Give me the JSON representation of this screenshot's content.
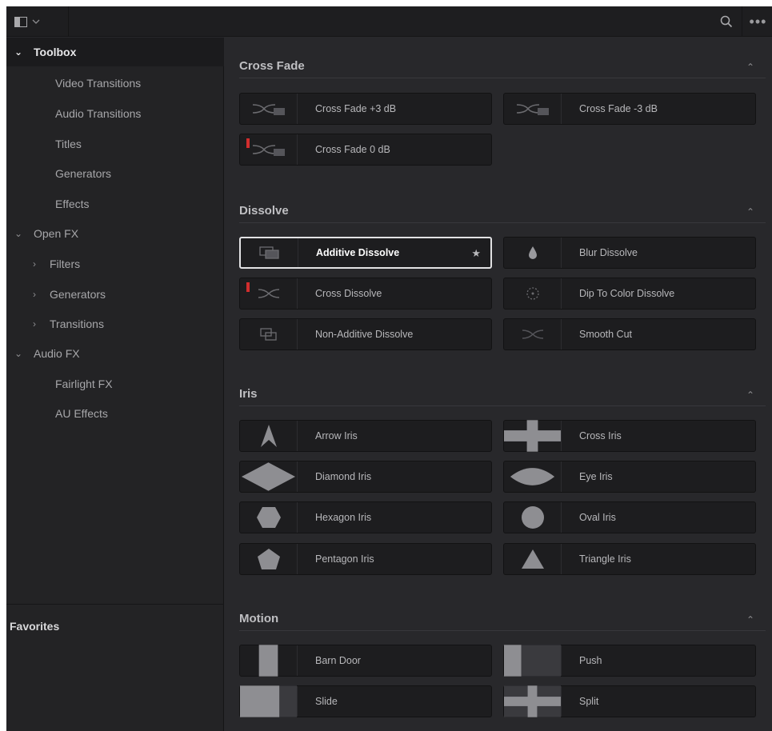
{
  "topbar": {
    "panel_icon": "panel-toggle-icon",
    "search_icon": "search-icon",
    "more_icon": "more-options-icon",
    "more_text": "•••"
  },
  "sidebar": {
    "items": [
      {
        "label": "Toolbox",
        "arrow": "⌄",
        "indent": 0,
        "selected": true
      },
      {
        "label": "Video Transitions",
        "arrow": "",
        "indent": 2
      },
      {
        "label": "Audio Transitions",
        "arrow": "",
        "indent": 2
      },
      {
        "label": "Titles",
        "arrow": "",
        "indent": 2
      },
      {
        "label": "Generators",
        "arrow": "",
        "indent": 2
      },
      {
        "label": "Effects",
        "arrow": "",
        "indent": 2
      },
      {
        "label": "Open FX",
        "arrow": "⌄",
        "indent": 0
      },
      {
        "label": "Filters",
        "arrow": "›",
        "indent": 1
      },
      {
        "label": "Generators",
        "arrow": "›",
        "indent": 1
      },
      {
        "label": "Transitions",
        "arrow": "›",
        "indent": 1
      },
      {
        "label": "Audio FX",
        "arrow": "⌄",
        "indent": 0
      },
      {
        "label": "Fairlight FX",
        "arrow": "",
        "indent": 2
      },
      {
        "label": "AU Effects",
        "arrow": "",
        "indent": 2
      }
    ],
    "favorites_label": "Favorites"
  },
  "sections": {
    "crossfade": {
      "title": "Cross Fade",
      "items": [
        {
          "label": "Cross Fade +3 dB",
          "icon": "crossfade-icon",
          "marker": false
        },
        {
          "label": "Cross Fade -3 dB",
          "icon": "crossfade-icon",
          "marker": false
        },
        {
          "label": "Cross Fade 0 dB",
          "icon": "crossfade-icon",
          "marker": true
        }
      ]
    },
    "dissolve": {
      "title": "Dissolve",
      "items": [
        {
          "label": "Additive Dissolve",
          "icon": "additive-dissolve-icon",
          "highlight": true,
          "star": "★"
        },
        {
          "label": "Blur Dissolve",
          "icon": "drop-icon"
        },
        {
          "label": "Cross Dissolve",
          "icon": "cross-dissolve-icon",
          "marker": true
        },
        {
          "label": "Dip To Color Dissolve",
          "icon": "dip-color-icon"
        },
        {
          "label": "Non-Additive Dissolve",
          "icon": "non-additive-dissolve-icon"
        },
        {
          "label": "Smooth Cut",
          "icon": "smooth-cut-icon"
        }
      ]
    },
    "iris": {
      "title": "Iris",
      "items": [
        {
          "label": "Arrow Iris",
          "icon": "arrow-iris-icon"
        },
        {
          "label": "Cross Iris",
          "icon": "cross-iris-icon"
        },
        {
          "label": "Diamond Iris",
          "icon": "diamond-iris-icon"
        },
        {
          "label": "Eye Iris",
          "icon": "eye-iris-icon"
        },
        {
          "label": "Hexagon Iris",
          "icon": "hexagon-iris-icon"
        },
        {
          "label": "Oval Iris",
          "icon": "oval-iris-icon"
        },
        {
          "label": "Pentagon Iris",
          "icon": "pentagon-iris-icon"
        },
        {
          "label": "Triangle Iris",
          "icon": "triangle-iris-icon"
        }
      ]
    },
    "motion": {
      "title": "Motion",
      "items": [
        {
          "label": "Barn Door",
          "icon": "barn-door-icon"
        },
        {
          "label": "Push",
          "icon": "push-icon"
        },
        {
          "label": "Slide",
          "icon": "slide-icon"
        },
        {
          "label": "Split",
          "icon": "split-icon"
        }
      ]
    }
  },
  "collapse_glyph": "⌃"
}
